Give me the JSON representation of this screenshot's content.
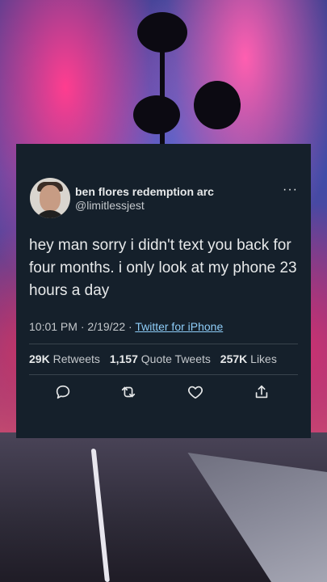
{
  "tweet": {
    "display_name": "ben flores redemption arc",
    "handle": "@limitlessjest",
    "more_label": "···",
    "text": "hey man sorry i didn't text you back for four months. i only look at my phone 23 hours a day",
    "time": "10:01 PM",
    "sep1": " · ",
    "date": "2/19/22",
    "sep2": " · ",
    "source": "Twitter for iPhone",
    "stats": {
      "retweets_count": "29K",
      "retweets_label": "Retweets",
      "quotes_count": "1,157",
      "quotes_label": "Quote Tweets",
      "likes_count": "257K",
      "likes_label": "Likes"
    },
    "actions": [
      "reply-icon",
      "retweet-icon",
      "like-icon",
      "share-icon"
    ]
  },
  "colors": {
    "card_bg": "#15202b",
    "link": "#8ecdf8",
    "text": "#e7e9ea",
    "muted": "#c4c8cc"
  }
}
